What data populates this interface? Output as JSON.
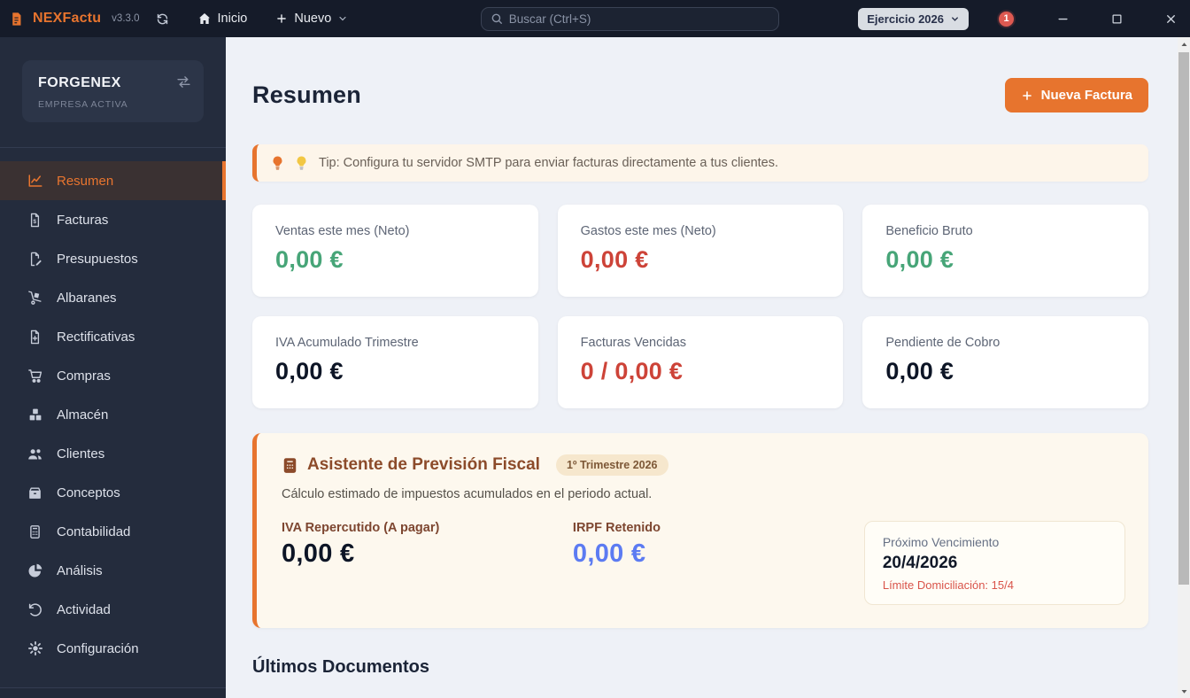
{
  "app": {
    "name": "NEXFactu",
    "version": "v3.3.0"
  },
  "titlebar": {
    "home_label": "Inicio",
    "new_label": "Nuevo",
    "search_placeholder": "Buscar (Ctrl+S)",
    "exercise_label": "Ejercicio 2026",
    "notification_count": "1"
  },
  "sidebar": {
    "company": {
      "name": "FORGENEX",
      "status": "EMPRESA ACTIVA"
    },
    "items": [
      {
        "label": "Resumen",
        "icon": "chart-line",
        "active": true
      },
      {
        "label": "Facturas",
        "icon": "file-invoice-dollar",
        "active": false
      },
      {
        "label": "Presupuestos",
        "icon": "file-pen",
        "active": false
      },
      {
        "label": "Albaranes",
        "icon": "dolly",
        "active": false
      },
      {
        "label": "Rectificativas",
        "icon": "file-plus",
        "active": false
      },
      {
        "label": "Compras",
        "icon": "shopping-cart",
        "active": false
      },
      {
        "label": "Almacén",
        "icon": "boxes",
        "active": false
      },
      {
        "label": "Clientes",
        "icon": "users",
        "active": false
      },
      {
        "label": "Conceptos",
        "icon": "box",
        "active": false
      },
      {
        "label": "Contabilidad",
        "icon": "calculator",
        "active": false
      },
      {
        "label": "Análisis",
        "icon": "pie-chart",
        "active": false
      },
      {
        "label": "Actividad",
        "icon": "history",
        "active": false
      },
      {
        "label": "Configuración",
        "icon": "gear",
        "active": false
      }
    ]
  },
  "main": {
    "title": "Resumen",
    "new_invoice_label": "Nueva Factura",
    "tip_text": "Tip: Configura tu servidor SMTP para enviar facturas directamente a tus clientes.",
    "stats": [
      {
        "label": "Ventas este mes (Neto)",
        "value": "0,00 €",
        "color": "green"
      },
      {
        "label": "Gastos este mes (Neto)",
        "value": "0,00 €",
        "color": "red"
      },
      {
        "label": "Beneficio Bruto",
        "value": "0,00 €",
        "color": "green"
      },
      {
        "label": "IVA Acumulado Trimestre",
        "value": "0,00 €",
        "color": "dark"
      },
      {
        "label": "Facturas Vencidas",
        "value": "0 / 0,00 €",
        "color": "red"
      },
      {
        "label": "Pendiente de Cobro",
        "value": "0,00 €",
        "color": "dark"
      }
    ],
    "fiscal": {
      "title": "Asistente de Previsión Fiscal",
      "badge": "1º Trimestre 2026",
      "description": "Cálculo estimado de impuestos acumulados en el periodo actual.",
      "iva_label": "IVA Repercutido (A pagar)",
      "iva_value": "0,00 €",
      "irpf_label": "IRPF Retenido",
      "irpf_value": "0,00 €",
      "due": {
        "label": "Próximo Vencimiento",
        "date": "20/4/2026",
        "limit": "Límite Domiciliación: 15/4"
      }
    },
    "last_documents_title": "Últimos Documentos"
  },
  "colors": {
    "accent_orange": "#e7742e",
    "positive_green": "#47a578",
    "negative_red": "#cd4338",
    "info_blue": "#5c7bf2",
    "dark_value": "#0d1526",
    "titlebar_bg": "#151b29",
    "sidebar_bg": "#242c3d"
  }
}
